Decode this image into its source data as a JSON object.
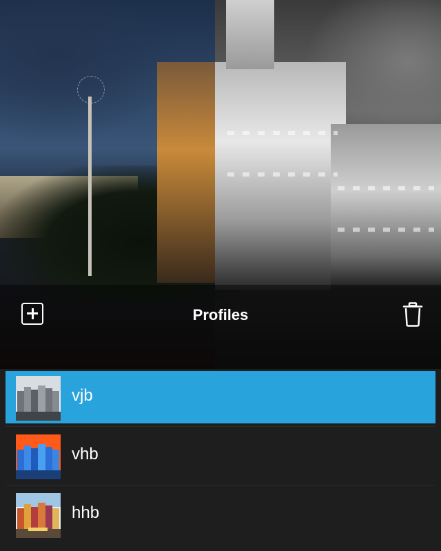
{
  "toolbar": {
    "title": "Profiles",
    "add_icon": "add-square-icon",
    "delete_icon": "trash-icon"
  },
  "profiles": [
    {
      "name": "vjb",
      "selected": true,
      "thumb_style": "gray"
    },
    {
      "name": "vhb",
      "selected": false,
      "thumb_style": "orange-blue"
    },
    {
      "name": "hhb",
      "selected": false,
      "thumb_style": "natural"
    }
  ],
  "colors": {
    "selection": "#28a3dc",
    "list_background": "#1e1e1e",
    "text": "#ffffff"
  }
}
